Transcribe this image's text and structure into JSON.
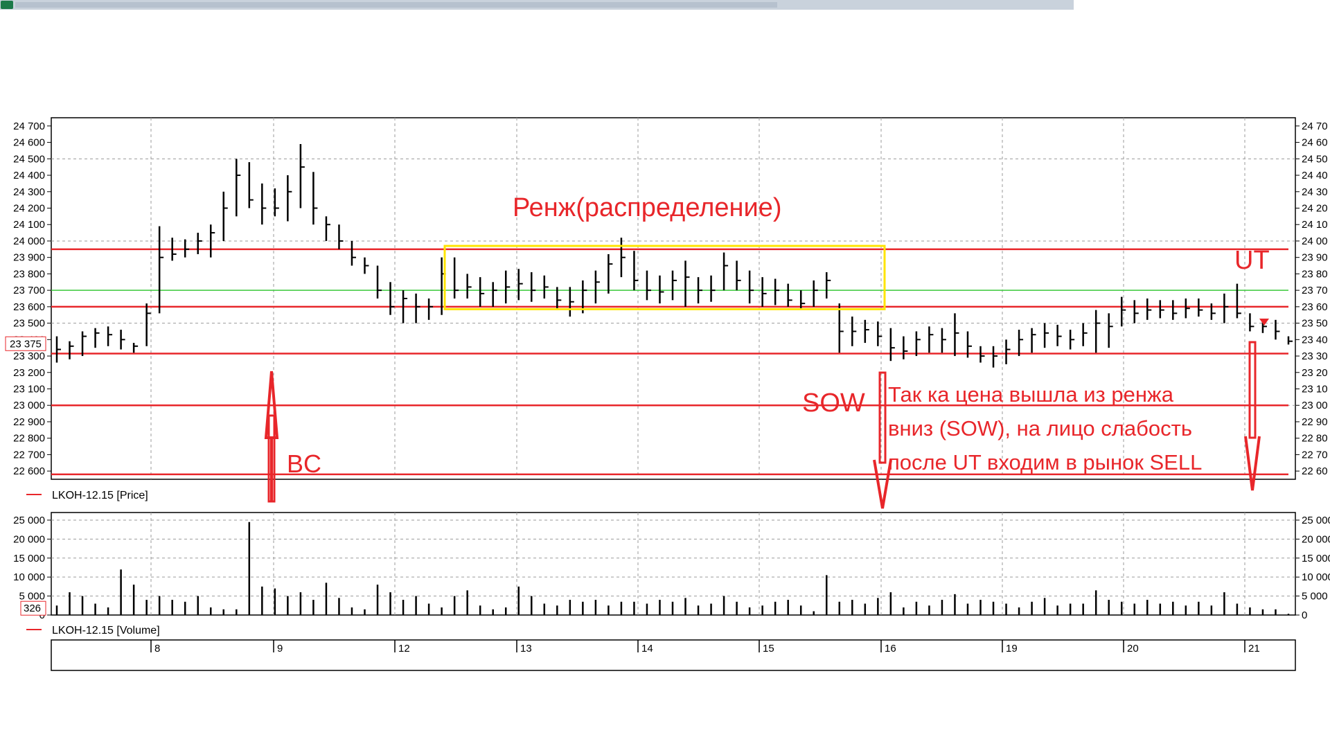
{
  "window": {
    "title_visible": false
  },
  "chart_data": {
    "type": "bar",
    "instrument": "LKOH-12.15",
    "price_panel": {
      "legend": "LKOH-12.15 [Price]",
      "ylim": [
        22550,
        24750
      ],
      "y_ticks": [
        22600,
        22700,
        22800,
        22900,
        23000,
        23100,
        23200,
        23300,
        23400,
        23500,
        23600,
        23700,
        23800,
        23900,
        24000,
        24100,
        24200,
        24300,
        24400,
        24500,
        24600,
        24700
      ],
      "y_tick_labels": [
        "22 600",
        "22 700",
        "22 800",
        "22 900",
        "23 000",
        "23 100",
        "23 200",
        "23 300",
        "23 400",
        "23 500",
        "23 600",
        "23 700",
        "23 800",
        "23 900",
        "24 000",
        "24 100",
        "24 200",
        "24 300",
        "24 400",
        "24 500",
        "24 600",
        "24 700"
      ],
      "last_price_label": "23 375",
      "last_price": 23375,
      "right_tick_labels": [
        "24 70",
        "24 60",
        "24 50",
        "24 40",
        "24 30",
        "24 20",
        "24 10",
        "24 00",
        "23 90",
        "23 80",
        "23 70",
        "23 60",
        "23 50",
        "23 40",
        "23 30",
        "23 20",
        "23 10",
        "23 00",
        "22 90",
        "22 80",
        "22 70",
        "22 60"
      ],
      "horizontal_levels": [
        {
          "name": "resistance-top",
          "price": 23950,
          "color": "#e8262a"
        },
        {
          "name": "range-mid",
          "price": 23700,
          "color": "#39c83a"
        },
        {
          "name": "range-low",
          "price": 23600,
          "color": "#e8262a"
        },
        {
          "name": "support-1",
          "price": 23315,
          "color": "#e8262a"
        },
        {
          "name": "support-2",
          "price": 23000,
          "color": "#e8262a"
        },
        {
          "name": "support-3",
          "price": 22580,
          "color": "#e8262a"
        }
      ],
      "range_box": {
        "price_top": 23970,
        "price_bottom": 23585,
        "color": "#ffe400"
      },
      "bars": [
        [
          23260,
          23420,
          23340
        ],
        [
          23280,
          23390,
          23360
        ],
        [
          23300,
          23450,
          23420
        ],
        [
          23350,
          23470,
          23440
        ],
        [
          23360,
          23480,
          23430
        ],
        [
          23340,
          23460,
          23400
        ],
        [
          23320,
          23380,
          23360
        ],
        [
          23360,
          23620,
          23560
        ],
        [
          23560,
          24090,
          23900
        ],
        [
          23880,
          24020,
          23920
        ],
        [
          23900,
          24010,
          23950
        ],
        [
          23920,
          24050,
          24000
        ],
        [
          23900,
          24100,
          24050
        ],
        [
          24000,
          24300,
          24200
        ],
        [
          24150,
          24500,
          24400
        ],
        [
          24200,
          24480,
          24250
        ],
        [
          24100,
          24350,
          24200
        ],
        [
          24150,
          24320,
          24200
        ],
        [
          24120,
          24400,
          24300
        ],
        [
          24200,
          24590,
          24450
        ],
        [
          24100,
          24420,
          24200
        ],
        [
          24000,
          24150,
          24100
        ],
        [
          23950,
          24100,
          24000
        ],
        [
          23850,
          24000,
          23900
        ],
        [
          23800,
          23900,
          23850
        ],
        [
          23650,
          23850,
          23700
        ],
        [
          23550,
          23750,
          23600
        ],
        [
          23500,
          23700,
          23650
        ],
        [
          23500,
          23680,
          23600
        ],
        [
          23520,
          23650,
          23600
        ],
        [
          23550,
          23900,
          23800
        ],
        [
          23650,
          23900,
          23700
        ],
        [
          23650,
          23800,
          23720
        ],
        [
          23600,
          23780,
          23680
        ],
        [
          23600,
          23750,
          23700
        ],
        [
          23620,
          23820,
          23720
        ],
        [
          23640,
          23830,
          23740
        ],
        [
          23630,
          23810,
          23700
        ],
        [
          23650,
          23790,
          23720
        ],
        [
          23580,
          23720,
          23640
        ],
        [
          23540,
          23720,
          23630
        ],
        [
          23560,
          23760,
          23700
        ],
        [
          23620,
          23820,
          23750
        ],
        [
          23680,
          23920,
          23860
        ],
        [
          23780,
          24020,
          23900
        ],
        [
          23700,
          23940,
          23760
        ],
        [
          23640,
          23820,
          23700
        ],
        [
          23620,
          23790,
          23690
        ],
        [
          23640,
          23820,
          23760
        ],
        [
          23600,
          23880,
          23780
        ],
        [
          23620,
          23780,
          23700
        ],
        [
          23630,
          23790,
          23700
        ],
        [
          23700,
          23930,
          23850
        ],
        [
          23700,
          23880,
          23760
        ],
        [
          23620,
          23820,
          23700
        ],
        [
          23600,
          23780,
          23680
        ],
        [
          23610,
          23770,
          23700
        ],
        [
          23600,
          23740,
          23640
        ],
        [
          23580,
          23700,
          23620
        ],
        [
          23600,
          23760,
          23700
        ],
        [
          23650,
          23810,
          23760
        ],
        [
          23320,
          23620,
          23450
        ],
        [
          23360,
          23540,
          23450
        ],
        [
          23380,
          23520,
          23460
        ],
        [
          23360,
          23510,
          23420
        ],
        [
          23270,
          23470,
          23350
        ],
        [
          23280,
          23420,
          23330
        ],
        [
          23300,
          23450,
          23400
        ],
        [
          23320,
          23480,
          23430
        ],
        [
          23320,
          23470,
          23400
        ],
        [
          23300,
          23560,
          23440
        ],
        [
          23290,
          23450,
          23360
        ],
        [
          23260,
          23360,
          23300
        ],
        [
          23230,
          23360,
          23300
        ],
        [
          23250,
          23400,
          23340
        ],
        [
          23300,
          23460,
          23400
        ],
        [
          23320,
          23470,
          23430
        ],
        [
          23350,
          23500,
          23440
        ],
        [
          23360,
          23490,
          23420
        ],
        [
          23340,
          23460,
          23400
        ],
        [
          23360,
          23500,
          23440
        ],
        [
          23320,
          23580,
          23500
        ],
        [
          23350,
          23560,
          23480
        ],
        [
          23480,
          23660,
          23580
        ],
        [
          23500,
          23640,
          23560
        ],
        [
          23520,
          23650,
          23580
        ],
        [
          23530,
          23640,
          23580
        ],
        [
          23520,
          23640,
          23560
        ],
        [
          23530,
          23650,
          23590
        ],
        [
          23540,
          23650,
          23580
        ],
        [
          23520,
          23620,
          23560
        ],
        [
          23500,
          23680,
          23600
        ],
        [
          23530,
          23740,
          23560
        ],
        [
          23450,
          23560,
          23480
        ],
        [
          23440,
          23520,
          23480
        ],
        [
          23400,
          23520,
          23450
        ],
        [
          23370,
          23420,
          23390
        ]
      ]
    },
    "volume_panel": {
      "legend": "LKOH-12.15 [Volume]",
      "ylim": [
        0,
        27000
      ],
      "y_ticks": [
        0,
        5000,
        10000,
        15000,
        20000,
        25000
      ],
      "y_tick_labels": [
        "0",
        "5 000",
        "10 000",
        "15 000",
        "20 000",
        "25 000"
      ],
      "last_volume_label": "326",
      "right_tick_labels": [
        "25 000",
        "20 000",
        "15 000",
        "10 000",
        "5 000",
        "0"
      ],
      "values": [
        2500,
        6000,
        5000,
        3000,
        2000,
        12000,
        8000,
        4000,
        5000,
        4000,
        3500,
        5000,
        2000,
        1500,
        1500,
        24500,
        7500,
        7000,
        5000,
        6000,
        4000,
        8500,
        4500,
        2000,
        1500,
        8000,
        6000,
        4000,
        5000,
        3000,
        2000,
        5000,
        6500,
        2500,
        1500,
        2000,
        7500,
        5000,
        3000,
        2500,
        4000,
        3500,
        4000,
        2500,
        3500,
        3500,
        3000,
        4000,
        3500,
        4500,
        2500,
        3000,
        5000,
        3500,
        2000,
        2500,
        3500,
        4000,
        2500,
        1000,
        10500,
        3500,
        4000,
        3000,
        4500,
        6000,
        2000,
        3500,
        2500,
        4000,
        5500,
        3000,
        4000,
        3500,
        3000,
        2000,
        3500,
        4500,
        2500,
        3000,
        3000,
        6500,
        4000,
        3500,
        3000,
        4000,
        3000,
        3500,
        2500,
        3500,
        2500,
        6000,
        3000,
        2000,
        1500,
        1500,
        326
      ]
    },
    "x_axis": {
      "tick_labels": [
        "8",
        "9",
        "12",
        "13",
        "14",
        "15",
        "16",
        "19",
        "20",
        "21"
      ]
    },
    "annotations": {
      "range_label": "Ренж(распределение)",
      "bc_label": "BC",
      "sow_label": "SOW",
      "ut_label": "UT",
      "comment_lines": [
        "Так ка цена вышла из ренжа",
        "вниз (SOW), на лицо слабость",
        "после UT входим в рынок SELL"
      ]
    },
    "colors": {
      "price_bars": "#000000",
      "levels": "#e8262a",
      "mid_level": "#39c83a",
      "range_box": "#ffe400",
      "annotations": "#e8262a",
      "grid": "#9a9a9a"
    }
  }
}
